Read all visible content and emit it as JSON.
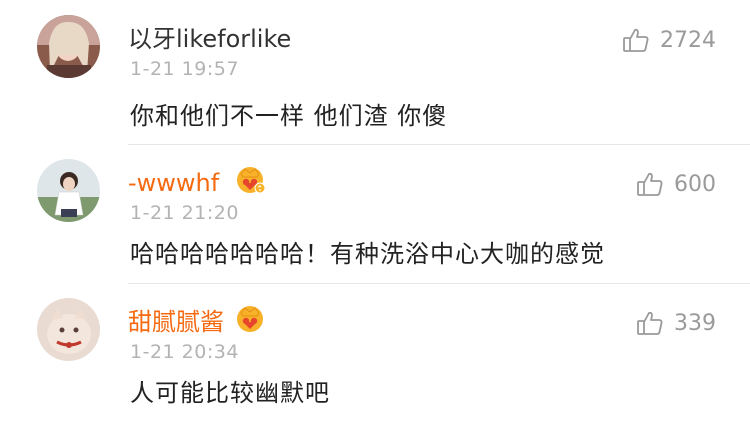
{
  "comments": [
    {
      "username": "以牙likeforlike",
      "vip": false,
      "time": "1-21 19:57",
      "text": "你和他们不一样  他们渣  你傻",
      "likes": "2724",
      "avatar": "avatar-photo"
    },
    {
      "username": "-wwwhf",
      "vip": true,
      "time": "1-21 21:20",
      "text": "哈哈哈哈哈哈哈！有种洗浴中心大咖的感觉",
      "likes": "600",
      "avatar": "avatar-photo"
    },
    {
      "username": "甜腻腻酱",
      "vip": true,
      "time": "1-21 20:34",
      "text": "人可能比较幽默吧",
      "likes": "339",
      "avatar": "avatar-photo"
    }
  ],
  "icons": {
    "like": "thumbs-up-icon",
    "vip_badge": "vip-crown-badge-icon"
  },
  "colors": {
    "username_plain": "#333333",
    "username_vip": "#f56a11",
    "meta": "#b3b3b3",
    "body_text": "#222222",
    "like": "#9a9a9a",
    "divider": "#e6e6e6"
  }
}
